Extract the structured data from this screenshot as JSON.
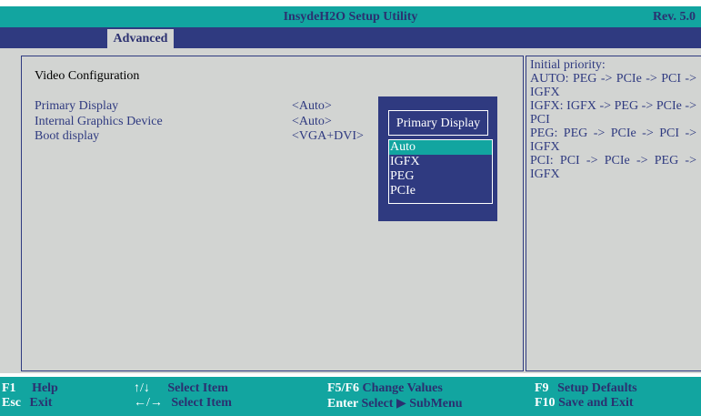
{
  "header": {
    "title": "InsydeH2O Setup Utility",
    "revision": "Rev. 5.0"
  },
  "tabs": [
    {
      "label": "Advanced",
      "active": true
    }
  ],
  "main": {
    "section_title": "Video Configuration",
    "settings": [
      {
        "label": "Primary Display",
        "value": "<Auto>"
      },
      {
        "label": "Internal Graphics Device",
        "value": "<Auto>"
      },
      {
        "label": "Boot display",
        "value": "<VGA+DVI>"
      }
    ]
  },
  "help": {
    "lines": [
      "Initial priority:",
      "AUTO: PEG -> PCIe -> PCI -> IGFX",
      "IGFX: IGFX -> PEG -> PCIe -> PCI",
      "PEG: PEG -> PCIe -> PCI -> IGFX",
      "PCI: PCI -> PCIe -> PEG -> IGFX"
    ]
  },
  "popup": {
    "title": "Primary Display",
    "options": [
      "Auto",
      "IGFX",
      "PEG",
      "PCIe"
    ],
    "selected_index": 0
  },
  "footer": {
    "f1": {
      "key": "F1",
      "desc": "Help"
    },
    "esc": {
      "key": "Esc",
      "desc": "Exit"
    },
    "updown": {
      "key": "↑/↓",
      "desc": "Select Item"
    },
    "leftright": {
      "key": "←/→",
      "desc": "Select Item"
    },
    "f5f6": {
      "key": "F5/F6",
      "desc": "Change Values"
    },
    "enter": {
      "key": "Enter",
      "desc": "Select ▶ SubMenu"
    },
    "f9": {
      "key": "F9",
      "desc": "Setup Defaults"
    },
    "f10": {
      "key": "F10",
      "desc": "Save and Exit"
    }
  },
  "colors": {
    "accent_teal": "#12a5a0",
    "navy": "#2f3a80",
    "panel_gray": "#d2d4d2"
  }
}
